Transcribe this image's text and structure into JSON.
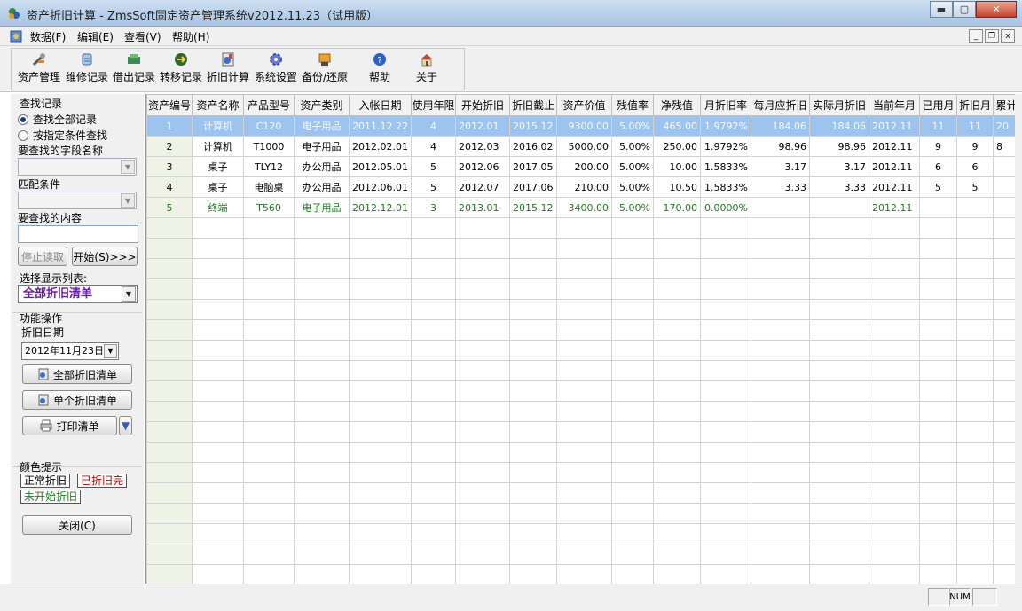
{
  "window": {
    "title": "资产折旧计算 - ZmsSoft固定资产管理系统v2012.11.23（试用版）",
    "min_label": "▬",
    "max_label": "▢",
    "close_label": "✕"
  },
  "menu": {
    "items": [
      "数据(F)",
      "编辑(E)",
      "查看(V)",
      "帮助(H)"
    ],
    "mdi_min": "_",
    "mdi_restore": "❐",
    "mdi_close": "x"
  },
  "toolbar": {
    "buttons": [
      {
        "label": "资产管理",
        "icon": "tools-icon"
      },
      {
        "label": "维修记录",
        "icon": "repair-icon"
      },
      {
        "label": "借出记录",
        "icon": "lend-icon"
      },
      {
        "label": "转移记录",
        "icon": "transfer-icon"
      },
      {
        "label": "折旧计算",
        "icon": "calc-icon"
      },
      {
        "label": "系统设置",
        "icon": "settings-icon"
      },
      {
        "label": "备份/还原",
        "icon": "backup-icon"
      },
      {
        "label": "帮助",
        "icon": "help-icon"
      },
      {
        "label": "关于",
        "icon": "about-icon"
      }
    ]
  },
  "search": {
    "section_label": "查找记录",
    "radio_all": "查找全部记录",
    "radio_cond": "按指定条件查找",
    "field_label": "要查找的字段名称",
    "match_label": "匹配条件",
    "content_label": "要查找的内容",
    "stop_label": "停止读取",
    "start_label": "开始(S)>>>"
  },
  "display": {
    "label": "选择显示列表:",
    "selected": "全部折旧清单"
  },
  "functions": {
    "section_label": "功能操作",
    "date_label": "折旧日期",
    "date_value": "2012年11月23日",
    "all_list_label": "全部折旧清单",
    "single_list_label": "单个折旧清单",
    "print_label": "打印清单"
  },
  "legend": {
    "title": "颜色提示",
    "normal": "正常折旧",
    "done": "已折旧完",
    "not_started": "未开始折旧",
    "colors": {
      "normal": "#000000",
      "done": "#c00000",
      "not_started": "#1f7a1f"
    }
  },
  "close_button": "关闭(C)",
  "grid": {
    "headers": [
      "资产编号",
      "资产名称",
      "产品型号",
      "资产类别",
      "入帐日期",
      "使用年限",
      "开始折旧",
      "折旧截止",
      "资产价值",
      "残值率",
      "净残值",
      "月折旧率",
      "每月应折旧",
      "实际月折旧",
      "当前年月",
      "已用月",
      "折旧月",
      "累计"
    ],
    "rows": [
      {
        "cells": [
          "1",
          "计算机",
          "C120",
          "电子用品",
          "2011.12.22",
          "4",
          "2012.01",
          "2015.12",
          "9300.00",
          "5.00%",
          "465.00",
          "1.9792%",
          "184.06",
          "184.06",
          "2012.11",
          "11",
          "11",
          "20"
        ],
        "state": "selected"
      },
      {
        "cells": [
          "2",
          "计算机",
          "T1000",
          "电子用品",
          "2012.02.01",
          "4",
          "2012.03",
          "2016.02",
          "5000.00",
          "5.00%",
          "250.00",
          "1.9792%",
          "98.96",
          "98.96",
          "2012.11",
          "9",
          "9",
          "8"
        ],
        "state": "normal"
      },
      {
        "cells": [
          "3",
          "桌子",
          "TLY12",
          "办公用品",
          "2012.05.01",
          "5",
          "2012.06",
          "2017.05",
          "200.00",
          "5.00%",
          "10.00",
          "1.5833%",
          "3.17",
          "3.17",
          "2012.11",
          "6",
          "6",
          ""
        ],
        "state": "normal"
      },
      {
        "cells": [
          "4",
          "桌子",
          "电脑桌",
          "办公用品",
          "2012.06.01",
          "5",
          "2012.07",
          "2017.06",
          "210.00",
          "5.00%",
          "10.50",
          "1.5833%",
          "3.33",
          "3.33",
          "2012.11",
          "5",
          "5",
          ""
        ],
        "state": "normal"
      },
      {
        "cells": [
          "5",
          "终端",
          "T560",
          "电子用品",
          "2012.12.01",
          "3",
          "2013.01",
          "2015.12",
          "3400.00",
          "5.00%",
          "170.00",
          "0.0000%",
          "",
          "",
          "2012.11",
          "",
          "",
          ""
        ],
        "state": "not_started"
      }
    ]
  },
  "statusbar": {
    "num": "NUM"
  }
}
